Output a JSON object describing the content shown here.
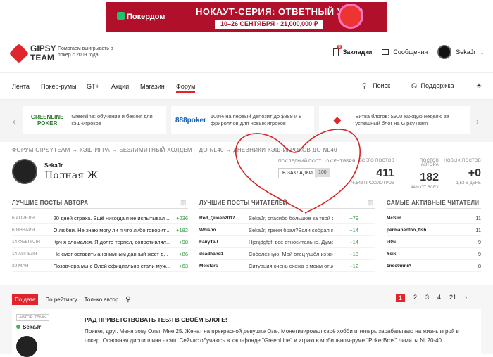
{
  "ad": {
    "brand": "Покердом",
    "headline": "НОКАУТ-СЕРИЯ: ОТВЕТНЫЙ УДАР",
    "dates": "10–26 СЕНТЯБРЯ · 21,000,000 ₽"
  },
  "header": {
    "logo": "GIPSY TEAM",
    "tagline": "Помогаем выигрывать в покер с 2009 года",
    "bookmarks_label": "Закладки",
    "bookmarks_count": "8",
    "messages_label": "Сообщения",
    "username": "SekaJr"
  },
  "nav": {
    "items": [
      "Лента",
      "Покер-румы",
      "GT+",
      "Акции",
      "Магазин",
      "Форум"
    ],
    "search": "Поиск",
    "support": "Поддержка"
  },
  "promos": [
    {
      "logo": "GREENLINE POKER",
      "text": "Greenline: обучение и бекинг для кэш-игроков"
    },
    {
      "logo": "888poker",
      "text": "100% на первый депозит до $888 и 8 фрироллов для новых игроков"
    },
    {
      "logo": "",
      "text": "Битва блогов: $900 каждую неделю за успешный блог на GipsyTeam"
    }
  ],
  "breadcrumb": "ФОРУМ GIPSYTEAM → КЭШ-ИГРА → БЕЗЛИМИТНЫЙ ХОЛДЕМ – ДО NL40 → ДНЕВНИКИ КЭШ-ИГРОКОВ ДО NL40",
  "topic": {
    "author": "SekaJr",
    "title": "Полная Ж",
    "last_post": "ПОСЛЕДНИЙ ПОСТ: 10 СЕНТЯБРЯ",
    "bookmark_btn": "В ЗАКЛАДКИ",
    "bookmark_count": "100"
  },
  "stats": [
    {
      "label": "ВСЕГО ПОСТОВ",
      "value": "411",
      "sub": "76,548 ПРОСМОТРОВ"
    },
    {
      "label": "ПОСТОВ АВТОРА",
      "value": "182",
      "sub": "44% ОТ ВСЕХ"
    },
    {
      "label": "НОВЫХ ПОСТОВ",
      "value": "+0",
      "sub": "1,53 В ДЕНЬ"
    }
  ],
  "sections": {
    "author_posts": "ЛУЧШИЕ ПОСТЫ АВТОРА",
    "reader_posts": "ЛУЧШИЕ ПОСТЫ ЧИТАТЕЛЕЙ",
    "active_readers": "САМЫЕ АКТИВНЫЕ ЧИТАТЕЛИ"
  },
  "author_posts": [
    {
      "date": "6 АПРЕЛЯ",
      "text": "20 дней страха. Ещё никогда я не испытывал ...",
      "score": "+236"
    },
    {
      "date": "6 ЯНВАРЯ",
      "text": "О любви. Не знаю могу ли я что либо говорит...",
      "score": "+182"
    },
    {
      "date": "14 ФЕВРАЛЯ",
      "text": "Крч я сломался. Я долго терпел, сопротивлял...",
      "score": "+98"
    },
    {
      "date": "14 АПРЕЛЯ",
      "text": "Не смог оставить анонимным данный жест д...",
      "score": "+86"
    },
    {
      "date": "29 МАЯ",
      "text": "Позавчера мы с Олей официально стали муж...",
      "score": "+63"
    }
  ],
  "reader_posts": [
    {
      "user": "Red_Queen2017",
      "text": "SekaJr, спасибо большое за твой отзыв, ...",
      "score": "+79"
    },
    {
      "user": "Whispo",
      "text": "SekaJr, трени брал?Если собрал подушку н...",
      "score": "+14"
    },
    {
      "user": "FairyTail",
      "text": "Hjcnjdgfgf, все относительно. Думаешь ка...",
      "score": "+14"
    },
    {
      "user": "deadhand1",
      "text": "Соболезную. Мой отец ушёл из жизни 21...",
      "score": "+13"
    },
    {
      "user": "Meistars",
      "text": "Ситуация очень схожа с моим отцом. Я ра...",
      "score": "+12"
    }
  ],
  "readers": [
    {
      "user": "McSim",
      "count": "11"
    },
    {
      "user": "permanentno_fish",
      "count": "11"
    },
    {
      "user": "i40u",
      "count": "9"
    },
    {
      "user": "Ysik",
      "count": "9"
    },
    {
      "user": "1nso0mniA",
      "count": "8"
    }
  ],
  "tabs": {
    "by_date": "По дате",
    "by_rating": "По рейтингу",
    "author_only": "Только автор"
  },
  "pages": [
    "1",
    "2",
    "3",
    "4",
    "21"
  ],
  "post": {
    "tag": "АВТОР ТЕМЫ",
    "user": "SekaJr",
    "title": "РАД ПРИВЕТСТВОВАТЬ ТЕБЯ В СВОЁМ БЛОГЕ!",
    "body": "Привет, друг. Меня зову Олег. Мне 25. Женат на прекрасной девушке Оле. Монетизировал своё хобби и теперь зарабатываю на жизнь игрой в покер. Основная дисциплина - кэш. Сейчас обучаюсь в кэш-фонде \"GreenLine\" и играю в мобильном-руме \"PokerBros\" лимиты NL20-40."
  },
  "colors": {
    "accent": "#e0252c",
    "positive": "#2e9a3a",
    "heart": "#d62222"
  }
}
